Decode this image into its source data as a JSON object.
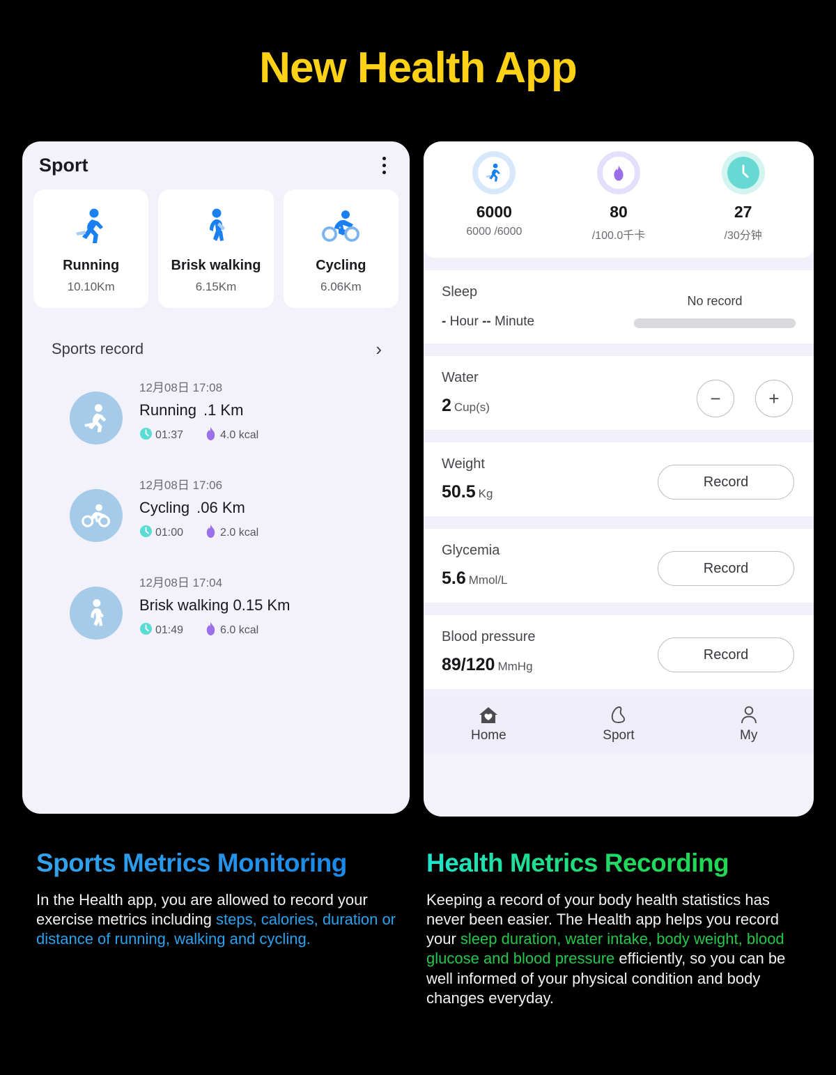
{
  "header": {
    "title": "New Health App",
    "color": "#FCD116"
  },
  "left_phone": {
    "app_title": "Sport",
    "menu_icon": "kebab-menu-icon",
    "activity_cards": [
      {
        "icon": "running-icon",
        "name": "Running",
        "distance": "10.10Km"
      },
      {
        "icon": "walking-icon",
        "name": "Brisk walking",
        "distance": "6.15Km"
      },
      {
        "icon": "cycling-icon",
        "name": "Cycling",
        "distance": "6.06Km"
      }
    ],
    "records_section": {
      "label": "Sports record",
      "chevron": "chevron-right-icon"
    },
    "records": [
      {
        "icon": "running-icon",
        "date": "12月08日 17:08",
        "activity": "Running",
        "distance": ".1 Km",
        "duration": "01:37",
        "calories": "4.0 kcal"
      },
      {
        "icon": "cycling-icon",
        "date": "12月08日 17:06",
        "activity": "Cycling",
        "distance": ".06 Km",
        "duration": "01:00",
        "calories": "2.0 kcal"
      },
      {
        "icon": "walking-icon",
        "date": "12月08日 17:04",
        "activity": "Brisk walking 0.15 Km",
        "distance": "",
        "duration": "01:49",
        "calories": "6.0 kcal"
      }
    ]
  },
  "right_phone": {
    "top_stats": [
      {
        "icon": "running-icon",
        "value": "6000",
        "goal": "6000 /6000"
      },
      {
        "icon": "flame-icon",
        "value": "80",
        "goal": "/100.0千卡"
      },
      {
        "icon": "clock-icon",
        "value": "27",
        "goal": "/30分钟"
      }
    ],
    "sleep": {
      "label": "Sleep",
      "duration_hour": "-",
      "hour_unit": "Hour",
      "duration_minute": "--",
      "minute_unit": "Minute",
      "status": "No record"
    },
    "water": {
      "label": "Water",
      "value": "2",
      "unit": "Cup(s)",
      "minus_label": "−",
      "plus_label": "+"
    },
    "weight": {
      "label": "Weight",
      "value": "50.5",
      "unit": "Kg",
      "button": "Record"
    },
    "glycemia": {
      "label": "Glycemia",
      "value": "5.6",
      "unit": "Mmol/L",
      "button": "Record"
    },
    "blood_pressure": {
      "label": "Blood pressure",
      "value": "89/120",
      "unit": "MmHg",
      "button": "Record"
    },
    "nav": [
      {
        "icon": "home-heart-icon",
        "label": "Home"
      },
      {
        "icon": "shoe-icon",
        "label": "Sport"
      },
      {
        "icon": "person-icon",
        "label": "My"
      }
    ]
  },
  "sections": [
    {
      "title": "Sports Metrics Monitoring",
      "accent": "#2aa3ef",
      "body_parts": [
        {
          "text": "In the Health app, you are allowed to record your exercise metrics including ",
          "highlight": false
        },
        {
          "text": "steps, calories, duration or distance of running, walking and cycling.",
          "highlight": true
        }
      ]
    },
    {
      "title": "Health Metrics Recording",
      "accent": "#24c84a",
      "body_parts": [
        {
          "text": "Keeping a record of your body health statistics has never been easier. The Health app helps you record your ",
          "highlight": false
        },
        {
          "text": "sleep duration, water intake, body weight, blood glucose and blood pressure",
          "highlight": true
        },
        {
          "text": " efficiently, so you can be well informed of your physical condition and body changes everyday.",
          "highlight": false
        }
      ]
    }
  ]
}
